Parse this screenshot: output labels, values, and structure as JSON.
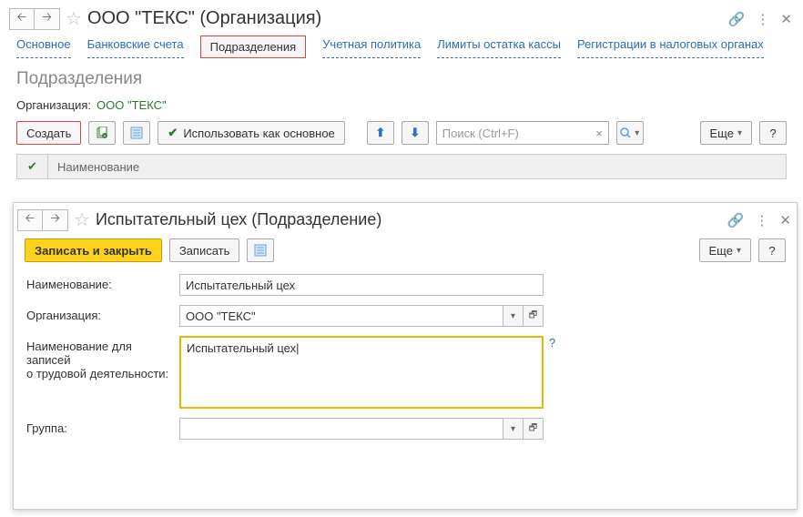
{
  "main": {
    "title": "ООО \"ТЕКС\" (Организация)",
    "tabs": [
      {
        "label": "Основное"
      },
      {
        "label": "Банковские счета"
      },
      {
        "label": "Подразделения"
      },
      {
        "label": "Учетная политика"
      },
      {
        "label": "Лимиты остатка кассы"
      },
      {
        "label": "Регистрации в налоговых органах"
      }
    ],
    "section_title": "Подразделения",
    "org_label": "Организация:",
    "org_value": "ООО \"ТЕКС\"",
    "toolbar": {
      "create": "Создать",
      "use_as_main": "Использовать как основное",
      "search_placeholder": "Поиск (Ctrl+F)",
      "more": "Еще",
      "help": "?"
    },
    "table": {
      "col_name": "Наименование"
    }
  },
  "child": {
    "title": "Испытательный цех (Подразделение)",
    "toolbar": {
      "save_close": "Записать и закрыть",
      "save": "Записать",
      "more": "Еще",
      "help": "?"
    },
    "fields": {
      "name_label": "Наименование:",
      "name_value": "Испытательный цех",
      "org_label": "Организация:",
      "org_value": "ООО \"ТЕКС\"",
      "labor_label_1": "Наименование для записей",
      "labor_label_2": "о трудовой деятельности:",
      "labor_value": "Испытательный цех",
      "group_label": "Группа:",
      "group_value": ""
    }
  },
  "glyphs": {
    "back": "🡠",
    "forward": "🡢",
    "star": "☆",
    "link": "🔗",
    "kebab": "⋮",
    "close": "✕",
    "check": "✔",
    "up": "⬆",
    "down": "⬇",
    "clear": "×",
    "caret": "▾",
    "open": "🗗",
    "help_q": "?"
  }
}
